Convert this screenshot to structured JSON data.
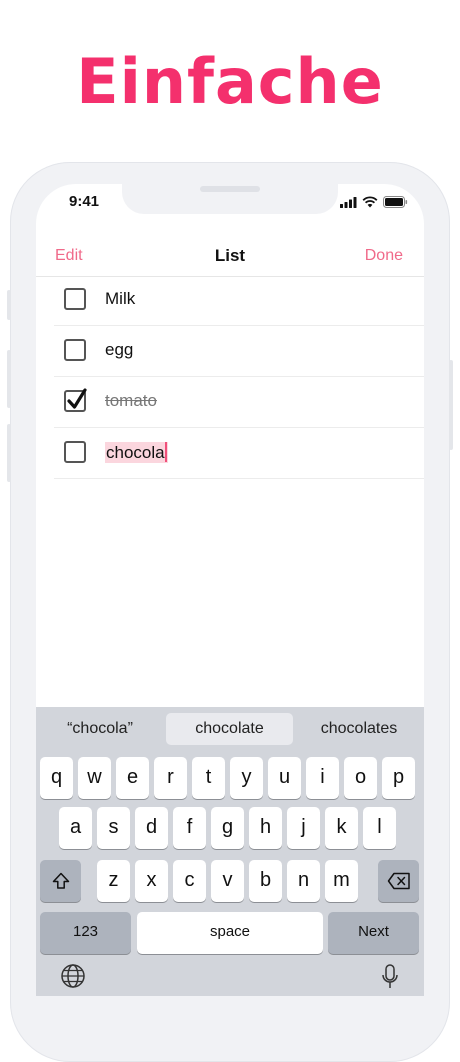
{
  "headline": "Einfache",
  "status_bar": {
    "time": "9:41"
  },
  "nav": {
    "edit_label": "Edit",
    "title": "List",
    "done_label": "Done"
  },
  "items": [
    {
      "text": "Milk",
      "checked": false
    },
    {
      "text": "egg",
      "checked": false
    },
    {
      "text": "tomato",
      "checked": true
    },
    {
      "text": "chocola",
      "checked": false,
      "editing": true
    }
  ],
  "suggestions": [
    "“chocola”",
    "chocolate",
    "chocolates"
  ],
  "keyboard": {
    "row1": [
      "q",
      "w",
      "e",
      "r",
      "t",
      "y",
      "u",
      "i",
      "o",
      "p"
    ],
    "row2": [
      "a",
      "s",
      "d",
      "f",
      "g",
      "h",
      "j",
      "k",
      "l"
    ],
    "row3": [
      "z",
      "x",
      "c",
      "v",
      "b",
      "n",
      "m"
    ],
    "numbers_label": "123",
    "space_label": "space",
    "next_label": "Next"
  },
  "colors": {
    "accent": "#f4306d",
    "nav_accent": "#f06a8a"
  },
  "icons": [
    "signal-icon",
    "wifi-icon",
    "battery-icon",
    "shift-icon",
    "backspace-icon",
    "globe-icon",
    "microphone-icon",
    "checkmark-icon"
  ]
}
